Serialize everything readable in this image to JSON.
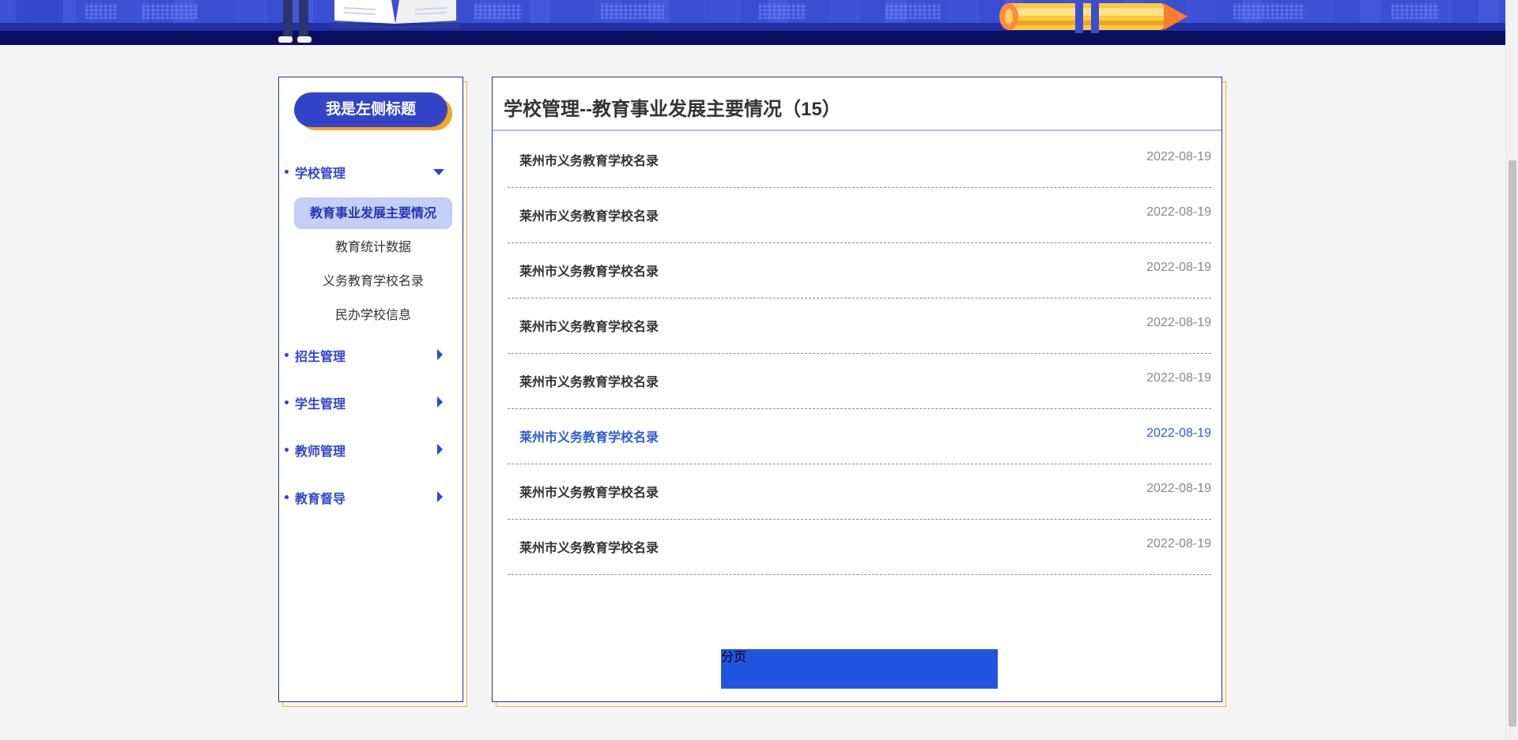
{
  "sidebar": {
    "title": "我是左侧标题",
    "groups": [
      {
        "label": "学校管理",
        "expanded": true
      },
      {
        "label": "招生管理",
        "expanded": false
      },
      {
        "label": "学生管理",
        "expanded": false
      },
      {
        "label": "教师管理",
        "expanded": false
      },
      {
        "label": "教育督导",
        "expanded": false
      }
    ],
    "sub_items": [
      {
        "label": "教育事业发展主要情况",
        "active": true
      },
      {
        "label": "教育统计数据",
        "active": false
      },
      {
        "label": "义务教育学校名录",
        "active": false
      },
      {
        "label": "民办学校信息",
        "active": false
      }
    ]
  },
  "main": {
    "title": "学校管理--教育事业发展主要情况（15）",
    "rows": [
      {
        "name": "莱州市义务教育学校名录",
        "date": "2022-08-19"
      },
      {
        "name": "莱州市义务教育学校名录",
        "date": "2022-08-19"
      },
      {
        "name": "莱州市义务教育学校名录",
        "date": "2022-08-19"
      },
      {
        "name": "莱州市义务教育学校名录",
        "date": "2022-08-19"
      },
      {
        "name": "莱州市义务教育学校名录",
        "date": "2022-08-19"
      },
      {
        "name": "莱州市义务教育学校名录",
        "date": "2022-08-19",
        "highlighted": true
      },
      {
        "name": "莱州市义务教育学校名录",
        "date": "2022-08-19"
      },
      {
        "name": "莱州市义务教育学校名录",
        "date": "2022-08-19"
      }
    ],
    "pagination_label": "分页"
  },
  "colors": {
    "accent_blue": "#2f45d0",
    "title_pill": "#3344c9",
    "title_pill_shadow": "#f5a623",
    "active_sub_bg": "#c3cff5",
    "link_hover": "#2a5bd7",
    "pager_bg": "#2155e0",
    "panel_border": "#2a2f9c",
    "panel_shadow_border": "#f5b335"
  }
}
